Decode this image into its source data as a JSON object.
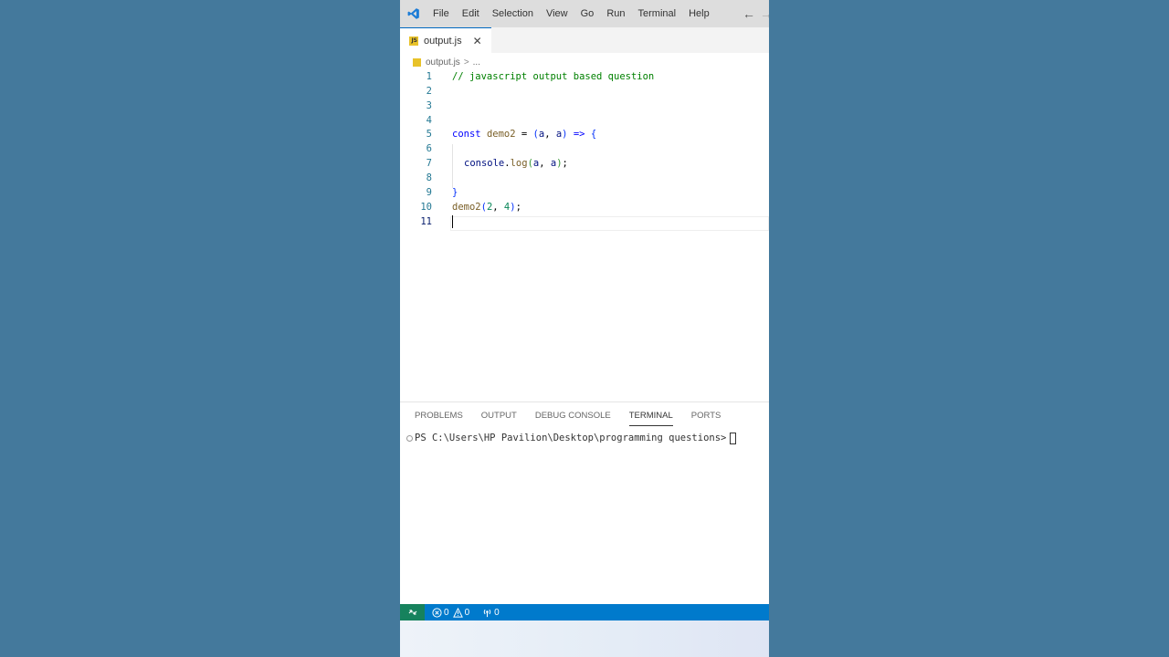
{
  "menubar": {
    "items": [
      "File",
      "Edit",
      "Selection",
      "View",
      "Go",
      "Run",
      "Terminal",
      "Help"
    ],
    "back_icon": "arrow-left-icon"
  },
  "tab": {
    "filename": "output.js",
    "close": "✕"
  },
  "breadcrumb": {
    "file": "output.js",
    "separator": ">",
    "more": "..."
  },
  "editor": {
    "line_numbers": [
      "1",
      "2",
      "3",
      "4",
      "5",
      "6",
      "7",
      "8",
      "9",
      "10",
      "11"
    ],
    "active_line": 11,
    "lines": {
      "l1": "// javascript output based question",
      "l5": {
        "kw": "const",
        "name": "demo2",
        "eq": "=",
        "open": "(",
        "a1": "a",
        "comma": ",",
        "a2": "a",
        "close": ")",
        "arrow": "=>",
        "brace": "{"
      },
      "l7": {
        "obj": "console",
        "dot": ".",
        "fn": "log",
        "open": "(",
        "a1": "a",
        "comma": ",",
        "a2": "a",
        "close": ")",
        "semi": ";"
      },
      "l9": {
        "brace": "}"
      },
      "l10": {
        "fn": "demo2",
        "open": "(",
        "n1": "2",
        "comma": ",",
        "n2": "4",
        "close": ")",
        "semi": ";"
      }
    }
  },
  "panel": {
    "tabs": [
      "PROBLEMS",
      "OUTPUT",
      "DEBUG CONSOLE",
      "TERMINAL",
      "PORTS"
    ],
    "active_tab": "TERMINAL",
    "terminal_prompt": "PS C:\\Users\\HP Pavilion\\Desktop\\programming questions>"
  },
  "statusbar": {
    "errors": "0",
    "warnings": "0",
    "ports": "0"
  },
  "colors": {
    "desktop": "#44799c",
    "statusbar": "#007acc",
    "remote": "#16825d",
    "js_icon": "#e8c229"
  }
}
